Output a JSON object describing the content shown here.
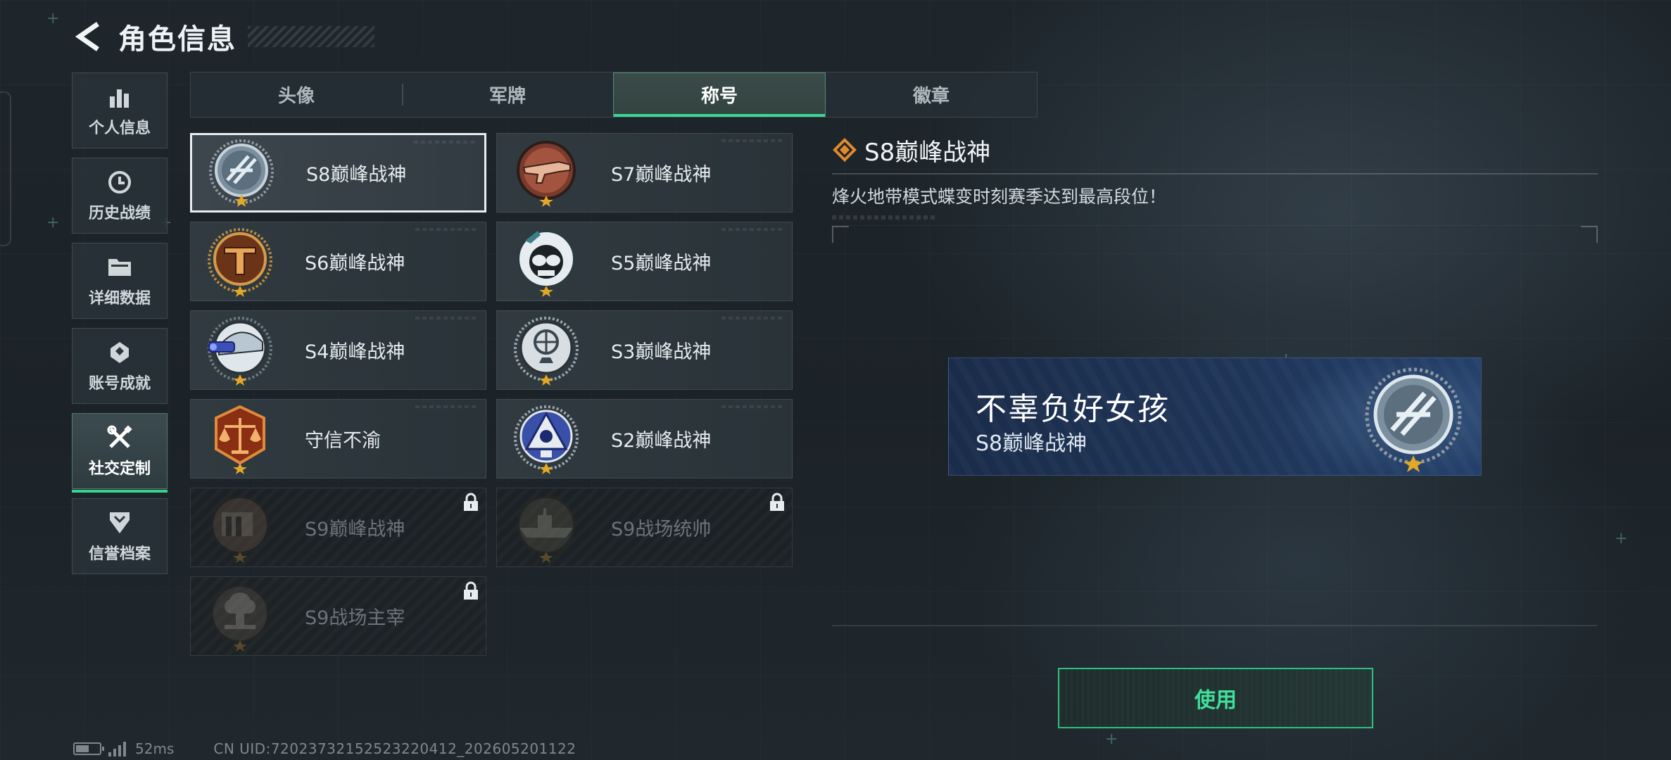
{
  "header": {
    "title": "角色信息"
  },
  "sidebar": {
    "items": [
      {
        "label": "个人信息",
        "icon": "bar-chart-icon",
        "active": false
      },
      {
        "label": "历史战绩",
        "icon": "history-icon",
        "active": false
      },
      {
        "label": "详细数据",
        "icon": "folder-icon",
        "active": false
      },
      {
        "label": "账号成就",
        "icon": "achievement-icon",
        "active": false
      },
      {
        "label": "社交定制",
        "icon": "tools-icon",
        "active": true
      },
      {
        "label": "信誉档案",
        "icon": "shield-chevron-icon",
        "active": false
      }
    ]
  },
  "tabs": [
    {
      "label": "头像",
      "active": false
    },
    {
      "label": "军牌",
      "active": false
    },
    {
      "label": "称号",
      "active": true
    },
    {
      "label": "徽章",
      "active": false
    }
  ],
  "titles": [
    {
      "name": "S8巅峰战神",
      "emblem": "s8-emblem-icon",
      "selected": true,
      "locked": false
    },
    {
      "name": "S7巅峰战神",
      "emblem": "s7-emblem-icon",
      "selected": false,
      "locked": false
    },
    {
      "name": "S6巅峰战神",
      "emblem": "s6-emblem-icon",
      "selected": false,
      "locked": false
    },
    {
      "name": "S5巅峰战神",
      "emblem": "s5-emblem-icon",
      "selected": false,
      "locked": false
    },
    {
      "name": "S4巅峰战神",
      "emblem": "s4-emblem-icon",
      "selected": false,
      "locked": false
    },
    {
      "name": "S3巅峰战神",
      "emblem": "s3-emblem-icon",
      "selected": false,
      "locked": false
    },
    {
      "name": "守信不渝",
      "emblem": "scales-emblem-icon",
      "selected": false,
      "locked": false
    },
    {
      "name": "S2巅峰战神",
      "emblem": "s2-emblem-icon",
      "selected": false,
      "locked": false
    },
    {
      "name": "S9巅峰战神",
      "emblem": "s9-emblem-icon",
      "selected": false,
      "locked": true
    },
    {
      "name": "S9战场统帅",
      "emblem": "s9-ship-emblem-icon",
      "selected": false,
      "locked": true
    },
    {
      "name": "S9战场主宰",
      "emblem": "s9-explosion-emblem-icon",
      "selected": false,
      "locked": true
    }
  ],
  "detail": {
    "title": "S8巅峰战神",
    "description": "烽火地带模式蝶变时刻赛季达到最高段位！"
  },
  "nameplate": {
    "player_name": "不辜负好女孩",
    "title": "S8巅峰战神"
  },
  "use_button": {
    "label": "使用"
  },
  "status": {
    "ping": "52ms",
    "uid": "CN UID:7202373215252322041​2_202605201122"
  },
  "colors": {
    "accent_green": "#37d38e",
    "gold_star": "#e2a826",
    "nameplate_blue": "#1f3558"
  }
}
